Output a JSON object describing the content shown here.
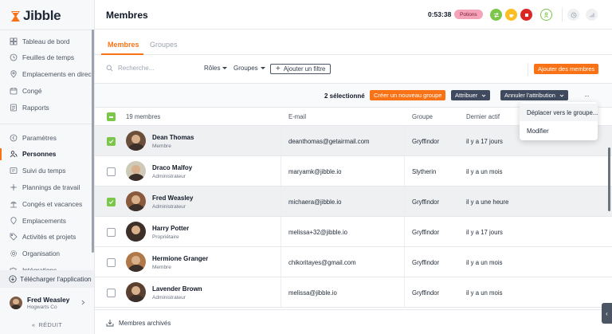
{
  "app": {
    "logo_text": "Jibble"
  },
  "sidebar": {
    "top_items": [
      {
        "label": "Tableau de bord",
        "icon": "dashboard-icon"
      },
      {
        "label": "Feuilles de temps",
        "icon": "clock-icon"
      },
      {
        "label": "Emplacements en direct",
        "icon": "map-pin-icon"
      },
      {
        "label": "Congé",
        "icon": "calendar-icon"
      },
      {
        "label": "Rapports",
        "icon": "report-icon"
      }
    ],
    "bottom_items": [
      {
        "label": "Paramètres",
        "icon": "chevron-left-icon"
      },
      {
        "label": "Personnes",
        "icon": "people-icon",
        "active": true
      },
      {
        "label": "Suivi du temps",
        "icon": "time-tracking-icon"
      },
      {
        "label": "Plannings de travail",
        "icon": "schedule-icon"
      },
      {
        "label": "Congés et vacances",
        "icon": "beach-icon"
      },
      {
        "label": "Emplacements",
        "icon": "location-icon"
      },
      {
        "label": "Activités et projets",
        "icon": "tag-icon"
      },
      {
        "label": "Organisation",
        "icon": "gear-icon"
      },
      {
        "label": "Intégrations",
        "icon": "puzzle-icon"
      }
    ],
    "download_label": "Télécharger l'application",
    "profile": {
      "name": "Fred Weasley",
      "org": "Hogwarts Co"
    },
    "reduce_label": "RÉDUIT"
  },
  "header": {
    "title": "Membres",
    "timer": "0:53:38",
    "activity_badge": "Potions"
  },
  "tabs": [
    {
      "label": "Membres",
      "active": true
    },
    {
      "label": "Groupes",
      "active": false
    }
  ],
  "toolbar": {
    "search_placeholder": "Recherche...",
    "roles_label": "Rôles",
    "groups_label": "Groupes",
    "add_filter_label": "Ajouter un filtre",
    "add_members_label": "Ajouter des membres"
  },
  "actions": {
    "selected_count": "2 sélectionné",
    "create_group_label": "Créer un nouveau groupe",
    "assign_label": "Attribuer",
    "unassign_label": "Annuler l'attribution",
    "more_label": "···"
  },
  "dropdown": {
    "items": [
      "Déplacer vers le groupe...",
      "Modifier"
    ]
  },
  "table": {
    "headers": {
      "members": "19 membres",
      "email": "E-mail",
      "group": "Groupe",
      "last_active": "Dernier actif"
    },
    "rows": [
      {
        "name": "Dean Thomas",
        "role": "Membre",
        "email": "deanthomas@getairmail.com",
        "group": "Gryffindor",
        "last_active": "il y a 17 jours",
        "selected": true
      },
      {
        "name": "Draco Malfoy",
        "role": "Administrateur",
        "email": "maryamk@jibble.io",
        "group": "Slytherin",
        "last_active": "il y a un mois",
        "selected": false
      },
      {
        "name": "Fred Weasley",
        "role": "Administrateur",
        "email": "michaera@jibble.io",
        "group": "Gryffindor",
        "last_active": "il y a une heure",
        "selected": true
      },
      {
        "name": "Harry Potter",
        "role": "Propriétaire",
        "email": "melissa+32@jibble.io",
        "group": "Gryffindor",
        "last_active": "il y a 17 jours",
        "selected": false
      },
      {
        "name": "Hermione Granger",
        "role": "Membre",
        "email": "chikoritayes@gmail.com",
        "group": "Gryffindor",
        "last_active": "il y a un mois",
        "selected": false
      },
      {
        "name": "Lavender Brown",
        "role": "Administrateur",
        "email": "melissa@jibble.io",
        "group": "Gryffindor",
        "last_active": "il y a un mois",
        "selected": false
      }
    ]
  },
  "footer": {
    "archived_label": "Membres archivés"
  },
  "colors": {
    "accent": "#f97316",
    "check": "#7cc64a",
    "dark_button": "#3f4a5e",
    "badge": "#f4a3b8"
  }
}
